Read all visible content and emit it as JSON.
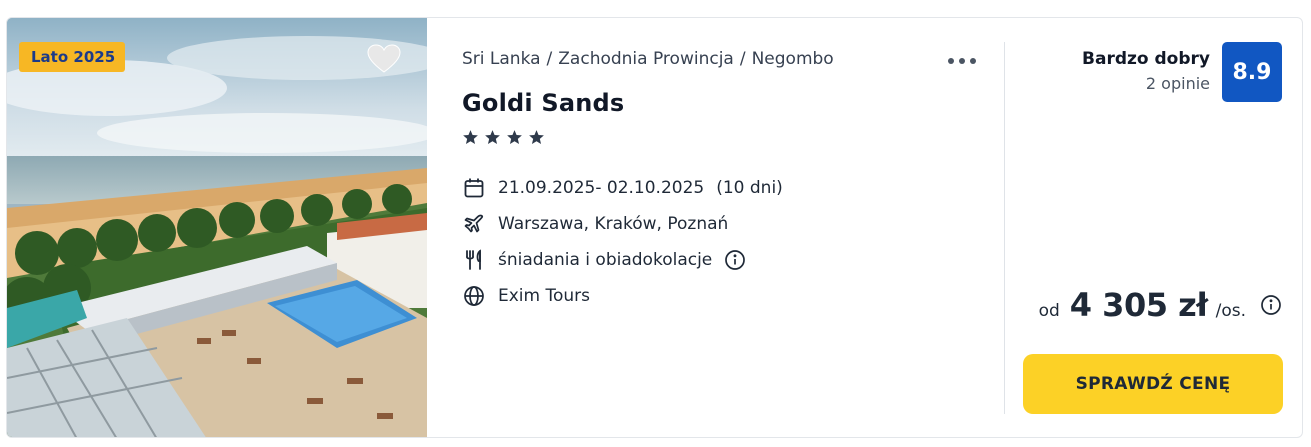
{
  "offer": {
    "season_badge": "Lato 2025",
    "breadcrumb": [
      "Sri Lanka",
      "Zachodnia Prowincja",
      "Negombo"
    ],
    "breadcrumb_separator": "/",
    "hotel_name": "Goldi Sands",
    "stars": 4,
    "dates": "21.09.2025- 02.10.2025",
    "duration": "(10 dni)",
    "departures": "Warszawa, Kraków, Poznań",
    "board": "śniadania i obiadokolacje",
    "operator": "Exim Tours",
    "icons": {
      "favorite": "heart-icon",
      "more": "more-dots-icon",
      "dates": "calendar-icon",
      "departures": "plane-icon",
      "board": "cutlery-icon",
      "operator": "globe-icon",
      "info": "info-icon"
    }
  },
  "rating": {
    "label": "Bardzo dobry",
    "count_text": "2 opinie",
    "score": "8.9"
  },
  "price": {
    "from_label": "od",
    "value": "4 305 zł",
    "unit": "/os."
  },
  "cta": {
    "label": "SPRAWDŹ CENĘ"
  },
  "colors": {
    "badge_bg": "#f7b724",
    "badge_text": "#1b3a8a",
    "score_bg": "#1157c2",
    "cta_bg": "#fcd126",
    "text": "#1f2937"
  }
}
